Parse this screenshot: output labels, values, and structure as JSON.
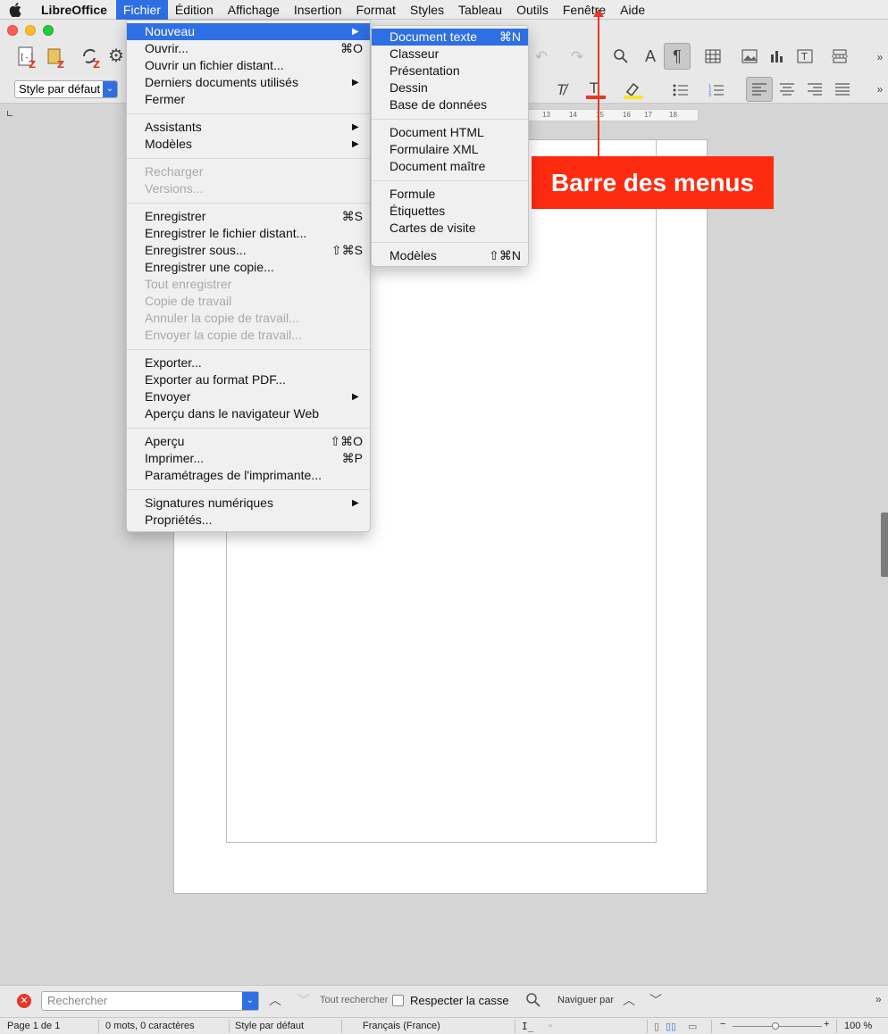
{
  "menubar": {
    "app": "LibreOffice",
    "items": [
      "Fichier",
      "Édition",
      "Affichage",
      "Insertion",
      "Format",
      "Styles",
      "Tableau",
      "Outils",
      "Fenêtre",
      "Aide"
    ]
  },
  "toolbar": {
    "style_value": "Style par défaut"
  },
  "fichier_menu": {
    "nouveau": "Nouveau",
    "ouvrir": "Ouvrir...",
    "ouvrir_sc": "⌘O",
    "ouvrir_distant": "Ouvrir un fichier distant...",
    "derniers": "Derniers documents utilisés",
    "fermer": "Fermer",
    "assistants": "Assistants",
    "modeles": "Modèles",
    "recharger": "Recharger",
    "versions": "Versions...",
    "enregistrer": "Enregistrer",
    "enregistrer_sc": "⌘S",
    "enregistrer_distant": "Enregistrer le fichier distant...",
    "enregistrer_sous": "Enregistrer sous...",
    "enregistrer_sous_sc": "⇧⌘S",
    "enregistrer_copie": "Enregistrer une copie...",
    "tout_enregistrer": "Tout enregistrer",
    "copie_travail": "Copie de travail",
    "annuler_copie": "Annuler la copie de travail...",
    "envoyer_copie": "Envoyer la copie de travail...",
    "exporter": "Exporter...",
    "exporter_pdf": "Exporter au format PDF...",
    "envoyer": "Envoyer",
    "apercu_web": "Aperçu dans le navigateur Web",
    "apercu": "Aperçu",
    "apercu_sc": "⇧⌘O",
    "imprimer": "Imprimer...",
    "imprimer_sc": "⌘P",
    "parametrages": "Paramétrages de l'imprimante...",
    "signatures": "Signatures numériques",
    "proprietes": "Propriétés..."
  },
  "nouveau_menu": {
    "document_texte": "Document texte",
    "document_texte_sc": "⌘N",
    "classeur": "Classeur",
    "presentation": "Présentation",
    "dessin": "Dessin",
    "base": "Base de données",
    "html": "Document HTML",
    "xml": "Formulaire XML",
    "maitre": "Document maître",
    "formule": "Formule",
    "etiquettes": "Étiquettes",
    "cartes": "Cartes de visite",
    "modeles": "Modèles",
    "modeles_sc": "⇧⌘N"
  },
  "annotation": {
    "label": "Barre des menus",
    "color": "#fe2b10"
  },
  "findbar": {
    "search_placeholder": "Rechercher",
    "tout_rechercher": "Tout rechercher",
    "respecter_casse": "Respecter la casse",
    "naviguer_par": "Naviguer par"
  },
  "statusbar": {
    "page": "Page 1 de 1",
    "words": "0 mots, 0 caractères",
    "style": "Style par défaut",
    "language": "Français (France)",
    "zoom": "100 %"
  },
  "ruler": {
    "ticks": [
      "13",
      "14",
      "15",
      "16",
      "17",
      "18"
    ]
  }
}
